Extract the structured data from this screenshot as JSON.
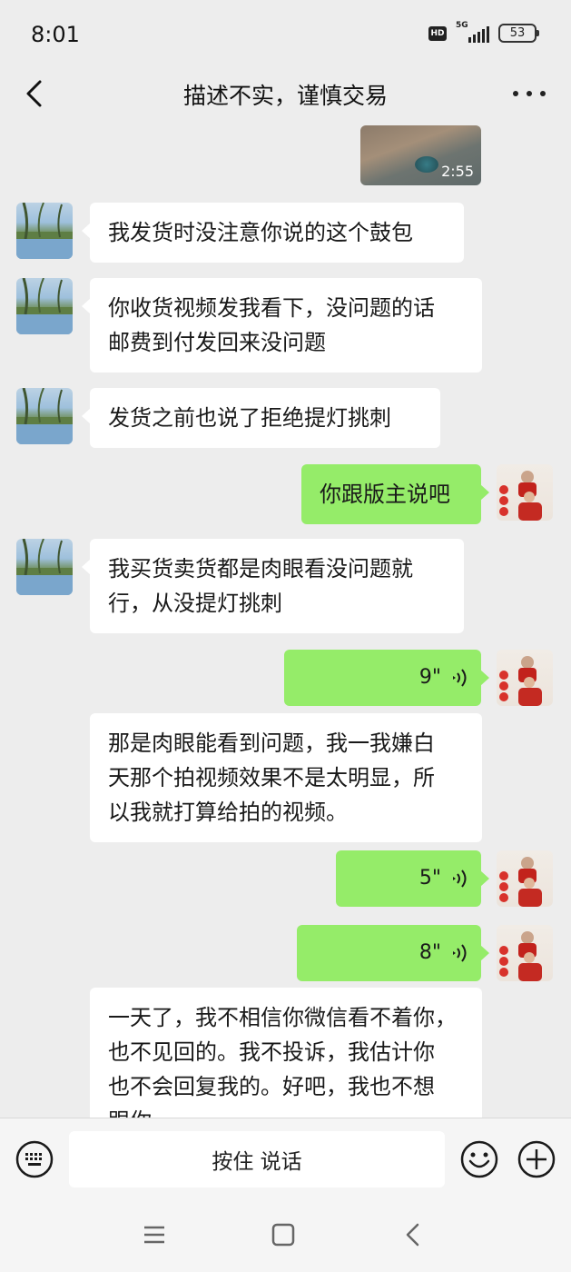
{
  "status_bar": {
    "time": "8:01",
    "hd": "HD",
    "network": "5G",
    "battery": "53"
  },
  "header": {
    "title": "描述不实，谨慎交易"
  },
  "video": {
    "duration": "2:55"
  },
  "messages": [
    {
      "side": "in",
      "lines": [
        "我发货时没注意你说的这个鼓包"
      ]
    },
    {
      "side": "in",
      "lines": [
        "你收货视频发我看下，没问题的话",
        "邮费到付发回来没问题"
      ]
    },
    {
      "side": "in",
      "lines": [
        "发货之前也说了拒绝提灯挑刺"
      ]
    },
    {
      "side": "out",
      "lines": [
        "你跟版主说吧"
      ]
    },
    {
      "side": "in",
      "lines": [
        "我买货卖货都是肉眼看没问题就",
        "行，从没提灯挑刺"
      ]
    },
    {
      "side": "out",
      "type": "voice",
      "duration": "9\""
    },
    {
      "side": "in",
      "lines": [
        "那是肉眼能看到问题，我一我嫌白",
        "天那个拍视频效果不是太明显，所",
        "以我就打算给拍的视频。"
      ]
    },
    {
      "side": "out",
      "type": "voice",
      "duration": "5\""
    },
    {
      "side": "out",
      "type": "voice",
      "duration": "8\""
    },
    {
      "side": "in",
      "lines": [
        "一天了，我不相信你微信看不着你，",
        "也不见回的。我不投诉，我估计你",
        "也不会回复我的。好吧，我也不想",
        "跟你"
      ]
    }
  ],
  "input": {
    "hold_to_talk": "按住 说话"
  },
  "icons": {
    "back": "back-arrow-icon",
    "more": "more-dots-icon",
    "keyboard": "keyboard-icon",
    "emoji": "emoji-icon",
    "plus": "plus-icon",
    "voice": "voice-wave-icon",
    "sys_menu": "menu-lines-icon",
    "sys_home": "home-square-icon",
    "sys_back": "back-chevron-icon"
  },
  "colors": {
    "background": "#ededed",
    "outgoing_bubble": "#95ec69",
    "incoming_bubble": "#ffffff"
  }
}
